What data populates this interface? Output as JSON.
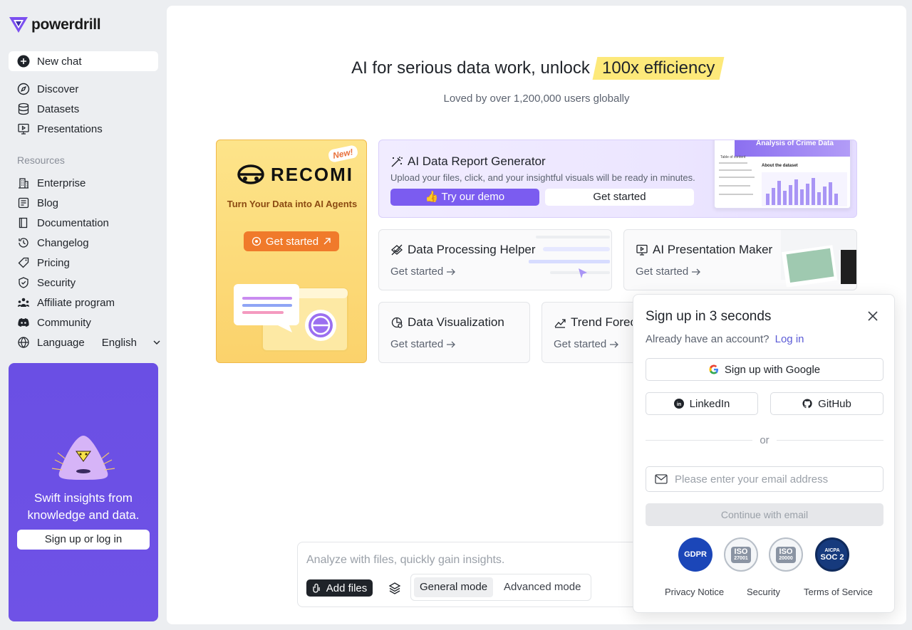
{
  "brand": {
    "name": "powerdrill"
  },
  "sidebar": {
    "new_chat": "New chat",
    "nav": [
      {
        "label": "Discover"
      },
      {
        "label": "Datasets"
      },
      {
        "label": "Presentations"
      }
    ],
    "resources_label": "Resources",
    "resources": [
      {
        "label": "Enterprise"
      },
      {
        "label": "Blog"
      },
      {
        "label": "Documentation"
      },
      {
        "label": "Changelog"
      },
      {
        "label": "Pricing"
      },
      {
        "label": "Security"
      },
      {
        "label": "Affiliate program"
      },
      {
        "label": "Community"
      },
      {
        "label": "Language"
      }
    ],
    "language_value": "English",
    "promo": {
      "text_line1": "Swift insights from",
      "text_line2": "knowledge and data.",
      "button": "Sign up or log in"
    }
  },
  "hero": {
    "headline_prefix": "AI for serious data work, unlock",
    "headline_highlight": "100x efficiency",
    "subline": "Loved by over 1,200,000 users globally"
  },
  "cards": {
    "recomi": {
      "badge": "New!",
      "logo": "RECOMI",
      "tagline": "Turn Your Data into AI Agents",
      "button": "Get started"
    },
    "report": {
      "title": "AI Data Report Generator",
      "desc": "Upload your files, click, and your insightful visuals will be ready in minutes.",
      "demo_button": "👍 Try our demo",
      "start_button": "Get started",
      "preview_title": "Analysis of Crime Data",
      "preview_toc": "Table of content",
      "preview_about": "About the dataset"
    },
    "processing": {
      "title": "Data Processing Helper",
      "link": "Get started"
    },
    "presentation": {
      "title": "AI Presentation Maker",
      "link": "Get started"
    },
    "visualization": {
      "title": "Data Visualization",
      "link": "Get started"
    },
    "trend": {
      "title": "Trend Forec",
      "link": "Get started"
    }
  },
  "composer": {
    "placeholder": "Analyze with files, quickly gain insights.",
    "add_files": "Add files",
    "modes": [
      "General mode",
      "Advanced mode"
    ],
    "active_mode": "General mode"
  },
  "modal": {
    "title": "Sign up in 3 seconds",
    "have_account": "Already have an account?",
    "login_link": "Log in",
    "google": "Sign up with Google",
    "linkedin": "LinkedIn",
    "github": "GitHub",
    "or": "or",
    "email_placeholder": "Please enter your email address",
    "continue": "Continue with email",
    "badges": [
      {
        "label": "GDPR"
      },
      {
        "label": "ISO",
        "sub": "27001"
      },
      {
        "label": "ISO",
        "sub": "20000"
      },
      {
        "label": "AICPA",
        "sub": "SOC 2"
      }
    ],
    "footer": [
      "Privacy Notice",
      "Security",
      "Terms of Service"
    ]
  },
  "colors": {
    "accent": "#7b5cf0",
    "promo_bg": "#6d4fe3",
    "highlight": "#fde97a",
    "recomi_orange": "#f07a2b"
  }
}
